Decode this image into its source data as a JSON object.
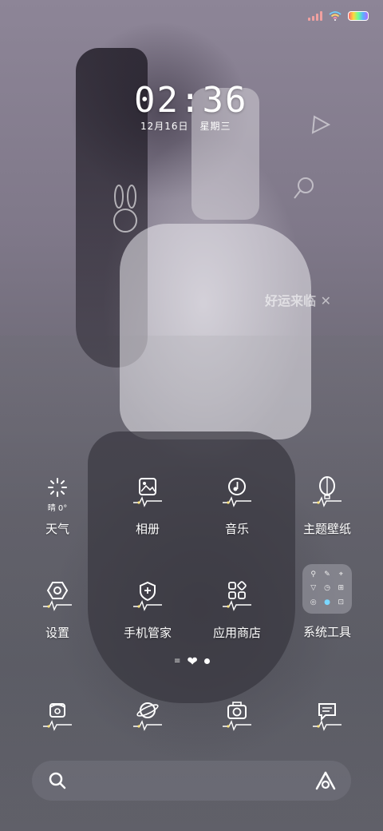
{
  "status_bar": {
    "signal": "signal-icon",
    "wifi": "wifi-icon",
    "battery": "battery-icon"
  },
  "clock": {
    "time": "02:36",
    "date": "12月16日",
    "weekday": "星期三"
  },
  "wallpaper_text": "好运来临",
  "apps_row1": [
    {
      "label": "天气",
      "icon": "weather-sun-icon",
      "sub": "晴 0°"
    },
    {
      "label": "相册",
      "icon": "gallery-icon"
    },
    {
      "label": "音乐",
      "icon": "music-icon"
    },
    {
      "label": "主题壁纸",
      "icon": "theme-balloon-icon"
    }
  ],
  "apps_row2": [
    {
      "label": "设置",
      "icon": "settings-icon"
    },
    {
      "label": "手机管家",
      "icon": "security-shield-icon"
    },
    {
      "label": "应用商店",
      "icon": "app-store-icon"
    },
    {
      "label": "系统工具",
      "icon": "folder-icon"
    }
  ],
  "dock": [
    {
      "icon": "phone-icon"
    },
    {
      "icon": "browser-planet-icon"
    },
    {
      "icon": "camera-icon"
    },
    {
      "icon": "messages-icon"
    }
  ],
  "colors": {
    "accent": "#ffffff",
    "pulse": "#ffe27a"
  }
}
